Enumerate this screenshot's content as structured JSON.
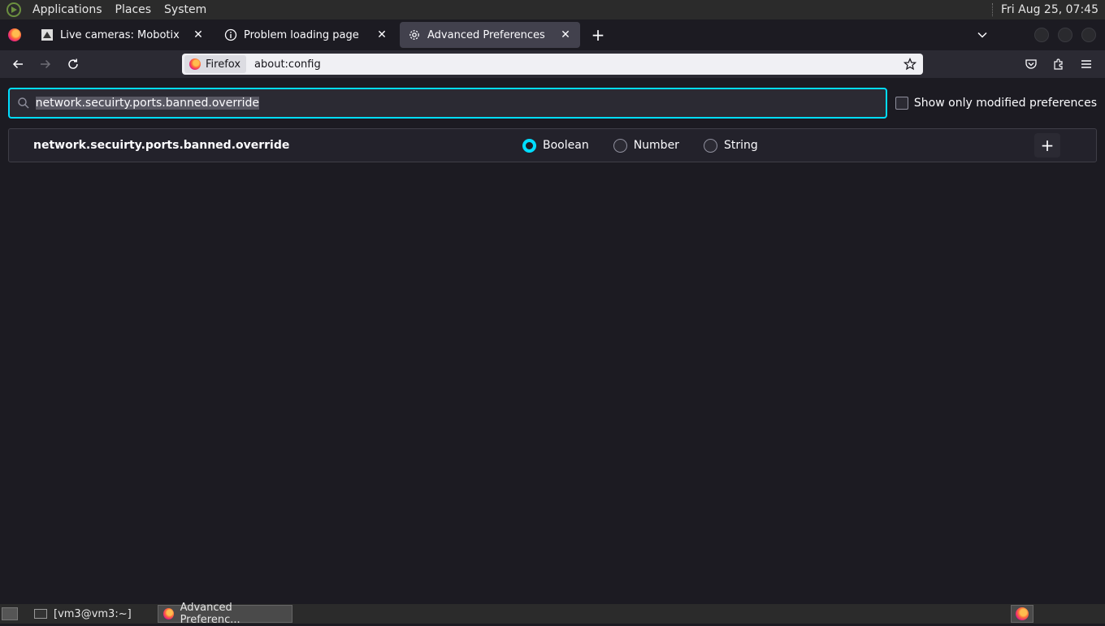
{
  "top_panel": {
    "menus": [
      "Applications",
      "Places",
      "System"
    ],
    "clock": "Fri Aug 25, 07:45"
  },
  "tabs": [
    {
      "label": "Live cameras: Mobotix",
      "icon": "camera-favicon-icon",
      "active": false
    },
    {
      "label": "Problem loading page",
      "icon": "info-icon",
      "active": false
    },
    {
      "label": "Advanced Preferences",
      "icon": "gear-icon",
      "active": true
    }
  ],
  "tab_close_glyph": "✕",
  "new_tab_glyph": "+",
  "urlbar": {
    "identity_label": "Firefox",
    "url": "about:config"
  },
  "config": {
    "search_value": "network.secuirty.ports.banned.override",
    "show_modified_label": "Show only modified preferences",
    "pref_name": "network.secuirty.ports.banned.override",
    "types": [
      "Boolean",
      "Number",
      "String"
    ],
    "selected_type": "Boolean",
    "add_glyph": "+"
  },
  "taskbar": {
    "tasks": [
      "[vm3@vm3:~]",
      "Advanced Preferenc..."
    ]
  },
  "colors": {
    "accent": "#00ddff",
    "page_bg": "#1c1b22",
    "toolbar_bg": "#2b2a33"
  }
}
